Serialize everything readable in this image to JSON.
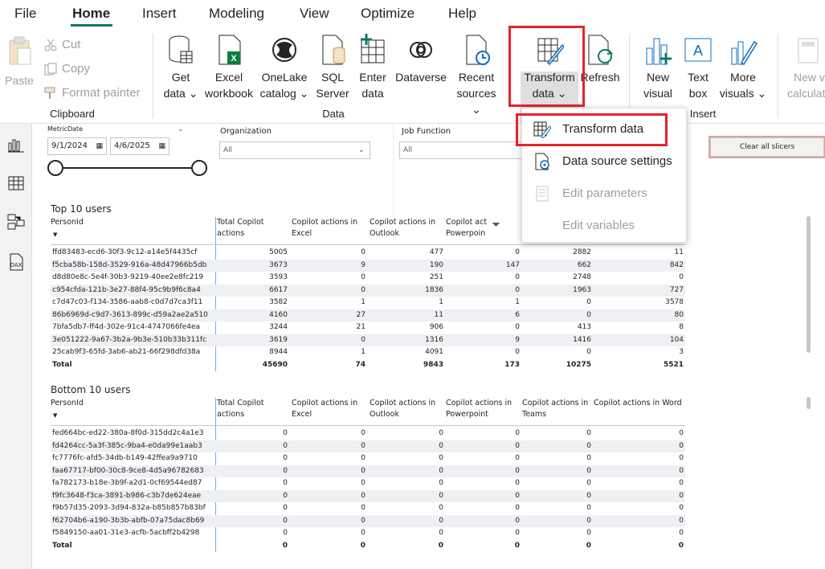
{
  "menu": [
    "File",
    "Home",
    "Insert",
    "Modeling",
    "View",
    "Optimize",
    "Help"
  ],
  "ribbon": {
    "clipboard": {
      "paste": "Paste",
      "cut": "Cut",
      "copy": "Copy",
      "format_painter": "Format painter",
      "group": "Clipboard"
    },
    "data": {
      "get_data": [
        "Get",
        "data"
      ],
      "excel": [
        "Excel",
        "workbook"
      ],
      "onelake": [
        "OneLake",
        "catalog"
      ],
      "sql": [
        "SQL",
        "Server"
      ],
      "enter": [
        "Enter",
        "data"
      ],
      "dataverse": "Dataverse",
      "recent": [
        "Recent",
        "sources"
      ],
      "transform": [
        "Transform",
        "data"
      ],
      "refresh": "Refresh",
      "group": "Data"
    },
    "insert": {
      "new_visual": [
        "New",
        "visual"
      ],
      "text_box": [
        "Text",
        "box"
      ],
      "more_visuals": [
        "More",
        "visuals"
      ],
      "group": "Insert"
    },
    "calc": [
      "New v",
      "calculat"
    ]
  },
  "dropdown": {
    "items": [
      "Transform data",
      "Data source settings",
      "Edit parameters",
      "Edit variables"
    ]
  },
  "slicers": {
    "metric_date_label": "MetricDate",
    "date_from": "9/1/2024",
    "date_to": "4/6/2025",
    "org_label": "Organization",
    "org_value": "All",
    "job_label": "Job Function",
    "job_value": "All",
    "clear": "Clear all slicers"
  },
  "top_table": {
    "title": "Top 10 users",
    "headers": [
      "PersonId",
      "Total Copilot actions",
      "Copilot actions in Excel",
      "Copilot actions in Outlook",
      "Copilot act Powerpoin",
      "",
      ""
    ],
    "rows": [
      [
        "ffd83483-ecd6-30f3-9c12-a14e5f4435cf",
        "5005",
        "0",
        "477",
        "0",
        "2882",
        "11"
      ],
      [
        "f5cba58b-158d-3529-916a-48d47966b5db",
        "3673",
        "9",
        "190",
        "147",
        "662",
        "842"
      ],
      [
        "d8d80e8c-5e4f-30b3-9219-40ee2e8fc219",
        "3593",
        "0",
        "251",
        "0",
        "2748",
        "0"
      ],
      [
        "c954cfda-121b-3e27-88f4-95c9b9f6c8a4",
        "6617",
        "0",
        "1836",
        "0",
        "1963",
        "727"
      ],
      [
        "c7d47c03-f134-3586-aab8-c0d7d7ca3f11",
        "3582",
        "1",
        "1",
        "1",
        "0",
        "3578"
      ],
      [
        "86b6969d-c9d7-3613-899c-d59a2ae2a510",
        "4160",
        "27",
        "11",
        "6",
        "0",
        "80"
      ],
      [
        "7bfa5db7-ff4d-302e-91c4-4747066fe4ea",
        "3244",
        "21",
        "906",
        "0",
        "413",
        "8"
      ],
      [
        "3e051222-9a67-3b2a-9b3e-510b33b311fc",
        "3619",
        "0",
        "1316",
        "9",
        "1416",
        "104"
      ],
      [
        "25cab9f3-65fd-3ab6-ab21-66f298dfd38a",
        "8944",
        "1",
        "4091",
        "0",
        "0",
        "3"
      ]
    ],
    "total": [
      "Total",
      "45690",
      "74",
      "9843",
      "173",
      "10275",
      "5521"
    ]
  },
  "bottom_table": {
    "title": "Bottom 10 users",
    "headers": [
      "PersonId",
      "Total Copilot actions",
      "Copilot actions in Excel",
      "Copilot actions in Outlook",
      "Copilot actions in Powerpoint",
      "Copilot actions in Teams",
      "Copilot actions in Word"
    ],
    "rows": [
      [
        "fed664bc-ed22-380a-8f0d-315dd2c4a1e3",
        "0",
        "0",
        "0",
        "0",
        "0",
        "0"
      ],
      [
        "fd4264cc-5a3f-385c-9ba4-e0da99e1aab3",
        "0",
        "0",
        "0",
        "0",
        "0",
        "0"
      ],
      [
        "fc7776fc-afd5-34db-b149-42ffea9a9710",
        "0",
        "0",
        "0",
        "0",
        "0",
        "0"
      ],
      [
        "faa67717-bf00-30c8-9ce8-4d5a96782683",
        "0",
        "0",
        "0",
        "0",
        "0",
        "0"
      ],
      [
        "fa782173-b18e-3b9f-a2d1-0cf69544ed87",
        "0",
        "0",
        "0",
        "0",
        "0",
        "0"
      ],
      [
        "f9fc3648-f3ca-3891-b986-c3b7de624eae",
        "0",
        "0",
        "0",
        "0",
        "0",
        "0"
      ],
      [
        "f9b57d35-2093-3d94-832a-b85b857b83bf",
        "0",
        "0",
        "0",
        "0",
        "0",
        "0"
      ],
      [
        "f62704b6-a190-3b3b-abfb-07a75dac8b69",
        "0",
        "0",
        "0",
        "0",
        "0",
        "0"
      ],
      [
        "f5849150-aa01-31e3-acfb-5acbff2b4298",
        "0",
        "0",
        "0",
        "0",
        "0",
        "0"
      ]
    ],
    "total": [
      "Total",
      "0",
      "0",
      "0",
      "0",
      "0",
      "0"
    ]
  },
  "colors": {
    "highlight": "#e3242b",
    "accent": "#117865",
    "alt_row": "#eef0f3"
  }
}
